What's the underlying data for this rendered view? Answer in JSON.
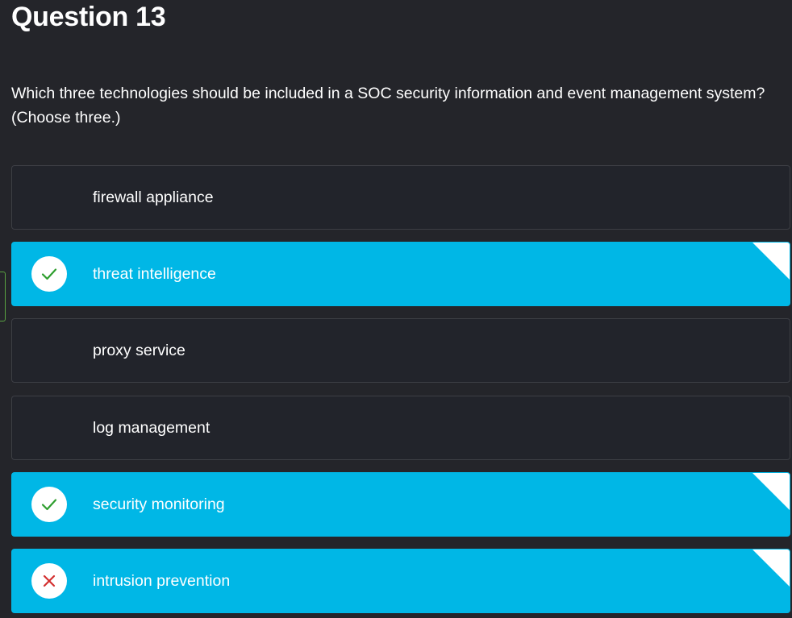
{
  "question": {
    "title": "Question 13",
    "text": "Which three technologies should be included in a SOC security information and event management system? (Choose three.)"
  },
  "options": [
    {
      "label": "firewall appliance",
      "selected": false,
      "status": ""
    },
    {
      "label": "threat intelligence",
      "selected": true,
      "status": "correct"
    },
    {
      "label": "proxy service",
      "selected": false,
      "status": ""
    },
    {
      "label": "log management",
      "selected": false,
      "status": ""
    },
    {
      "label": "security monitoring",
      "selected": true,
      "status": "correct"
    },
    {
      "label": "intrusion prevention",
      "selected": true,
      "status": "incorrect"
    }
  ],
  "colors": {
    "background": "#24252a",
    "selected": "#00b7e6",
    "correct": "#2e9e2e",
    "incorrect": "#d32f2f"
  }
}
